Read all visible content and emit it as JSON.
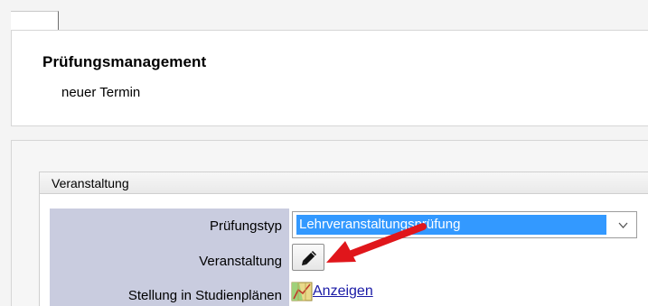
{
  "header": {
    "title": "Prüfungsmanagement",
    "subtitle": "neuer Termin"
  },
  "section": {
    "legend": "Veranstaltung"
  },
  "form": {
    "exam_type": {
      "label": "Prüfungstyp",
      "selected_value": "Lehrveranstaltungsprüfung"
    },
    "course": {
      "label": "Veranstaltung",
      "edit_icon": "pencil-icon"
    },
    "study_plans": {
      "label": "Stellung in Studienplänen",
      "icon": "map-icon",
      "link_text": "Anzeigen"
    }
  },
  "annotation": {
    "icon": "red-arrow-icon",
    "color": "#e0161b"
  },
  "colors": {
    "label_column": "#c9ccdf",
    "selection": "#3399ff",
    "link": "#1a1aa6"
  }
}
